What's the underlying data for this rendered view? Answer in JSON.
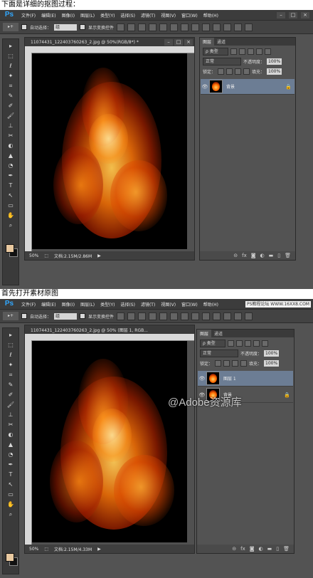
{
  "captions": {
    "top": "下面是详细的抠图过程：",
    "middle": "首先打开素材原图"
  },
  "app": {
    "logo": "Ps",
    "menus": [
      "文件(F)",
      "编辑(E)",
      "图像(I)",
      "图层(L)",
      "类型(Y)",
      "选择(S)",
      "滤镜(T)",
      "视图(V)",
      "窗口(W)",
      "帮助(H)"
    ],
    "site_watermark": "PS教程论坛 WWW.16XX8.COM",
    "window_controls": [
      "–",
      "□",
      "×"
    ]
  },
  "options_bar": {
    "auto_select_label": "自动选择：",
    "auto_select_value": "组",
    "show_transform_label": "显示变换控件"
  },
  "screenshot1": {
    "doc_title": "11074431_122403760263_2.jpg @ 50%(RGB/8*) *",
    "zoom": "50%",
    "doc_info": "文档:2.15M/2.86M",
    "panel_tabs": [
      "图层",
      "通道"
    ],
    "filter_kind": "ρ 类型",
    "blend_mode": "正常",
    "opacity_label": "不透明度：",
    "opacity_value": "100%",
    "lock_label": "锁定：",
    "fill_label": "填充：",
    "fill_value": "100%",
    "layers": [
      {
        "name": "背景",
        "selected": true,
        "locked": true
      }
    ]
  },
  "screenshot2": {
    "doc_title": "11074431_122403760263_2.jpg @ 50% (图层 1, RGB...",
    "zoom": "50%",
    "doc_info": "文档:2.15M/4.33M",
    "panel_tabs": [
      "图层",
      "通道"
    ],
    "filter_kind": "ρ 类型",
    "blend_mode": "正常",
    "opacity_label": "不透明度：",
    "opacity_value": "100%",
    "lock_label": "锁定：",
    "fill_label": "填充：",
    "fill_value": "100%",
    "layers": [
      {
        "name": "图层 1",
        "selected": true,
        "locked": false
      },
      {
        "name": "背景",
        "selected": false,
        "locked": true
      }
    ],
    "watermark": "@Adobe资源库"
  },
  "tool_glyphs": [
    "▸",
    "⬚",
    "ℓ",
    "✦",
    "⌗",
    "✎",
    "✐",
    "🖌",
    "⊥",
    "✂",
    "◐",
    "▲",
    "◔",
    "✒",
    "T",
    "↖",
    "▭",
    "✋",
    "⌕"
  ],
  "colors": {
    "ps_blue": "#31a8ff",
    "selected_layer": "#6c7d94",
    "panel_bg": "#535353",
    "foreground_swatch": "#e9c9a0",
    "background_swatch": "#111111"
  }
}
